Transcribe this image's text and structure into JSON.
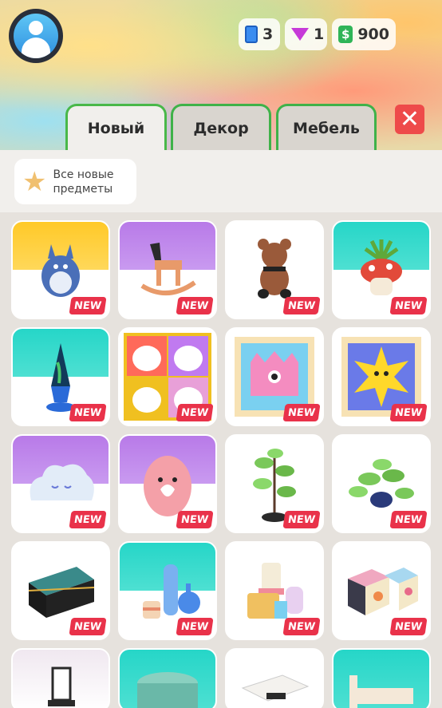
{
  "header": {
    "currencies": {
      "tickets": "3",
      "gems": "1",
      "cash": "900",
      "cash_symbol": "$"
    }
  },
  "tabs": [
    {
      "label": "Новый",
      "active": true
    },
    {
      "label": "Декор",
      "active": false
    },
    {
      "label": "Мебель",
      "active": false
    }
  ],
  "close_symbol": "✕",
  "filter": {
    "label": "Все новые предметы"
  },
  "badge_label": "NEW",
  "items": [
    {
      "name": "blue-plush-creature"
    },
    {
      "name": "rocking-horse"
    },
    {
      "name": "brown-teddy-bear"
    },
    {
      "name": "mushroom-planter"
    },
    {
      "name": "lava-lamp"
    },
    {
      "name": "cat-poster"
    },
    {
      "name": "pink-monster-painting"
    },
    {
      "name": "yellow-star-painting"
    },
    {
      "name": "cloud-pillow"
    },
    {
      "name": "pink-egg-lamp"
    },
    {
      "name": "tall-potted-plant"
    },
    {
      "name": "hanging-plant"
    },
    {
      "name": "vanity-case"
    },
    {
      "name": "vases-and-candle"
    },
    {
      "name": "bathroom-items"
    },
    {
      "name": "toy-blocks"
    },
    {
      "name": "chair"
    },
    {
      "name": "teal-pouf"
    },
    {
      "name": "white-table"
    },
    {
      "name": "bed"
    }
  ],
  "colors": {
    "accent_green": "#49b849",
    "badge_red": "#e9324a",
    "close_red": "#ee4a4a"
  }
}
